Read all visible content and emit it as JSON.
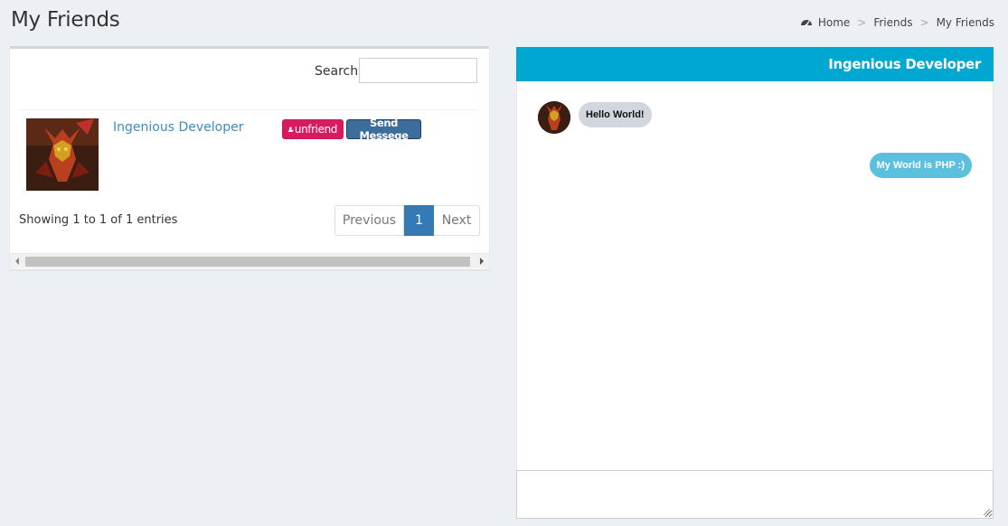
{
  "page": {
    "title": "My Friends"
  },
  "breadcrumb": {
    "items": [
      "Home",
      "Friends",
      "My Friends"
    ],
    "separator": ">"
  },
  "friends_table": {
    "search_label": "Search:",
    "search_value": "",
    "rows": [
      {
        "name": "Ingenious Developer",
        "unfriend_label": "unfriend",
        "message_label": "Send Messege"
      }
    ],
    "entries_info": "Showing 1 to 1 of 1 entries",
    "pagination": {
      "previous": "Previous",
      "current": "1",
      "next": "Next"
    }
  },
  "chat": {
    "title": "Ingenious Developer",
    "messages": [
      {
        "direction": "incoming",
        "text": "Hello World!"
      },
      {
        "direction": "outgoing",
        "text": "My World is PHP :)"
      }
    ],
    "input_value": ""
  },
  "colors": {
    "background": "#ecf0f5",
    "header": "#00a7d0",
    "unfriend": "#d81b60",
    "send": "#3c6d9c",
    "link": "#3c8dbc",
    "page_active": "#337ab7",
    "incoming_bubble": "#d2d6de",
    "outgoing_bubble": "#5bc0de"
  },
  "icons": {
    "breadcrumb": "dashboard-icon",
    "unfriend": "user-minus-icon"
  }
}
